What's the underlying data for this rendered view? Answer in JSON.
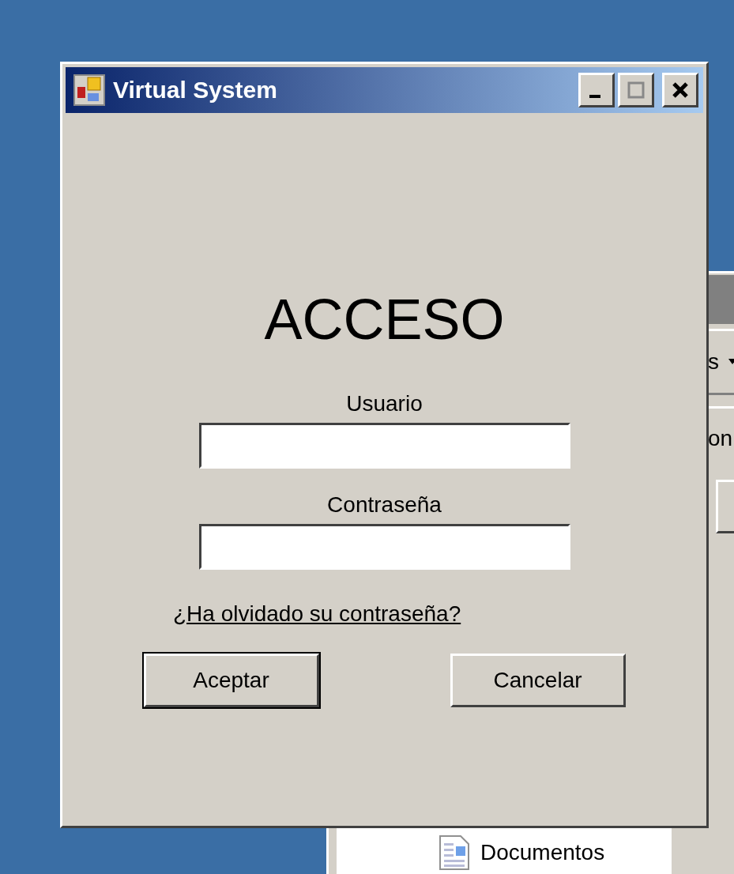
{
  "background_window": {
    "toolbar_text": "s",
    "row_text": "on",
    "file": {
      "label": "Documentos"
    }
  },
  "window": {
    "title": "Virtual System"
  },
  "heading": "ACCESO",
  "fields": [
    {
      "label": "Usuario"
    },
    {
      "label": "Contraseña"
    }
  ],
  "forgot_link": "¿Ha olvidado su contraseña?",
  "buttons": [
    {
      "label": "Aceptar",
      "default": true
    },
    {
      "label": "Cancelar",
      "default": false
    }
  ]
}
